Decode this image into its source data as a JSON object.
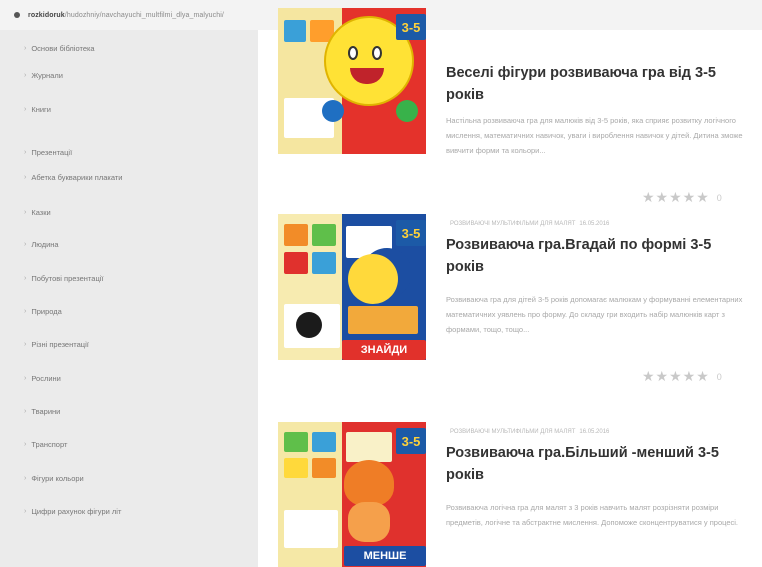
{
  "browser": {
    "url_prefix": "",
    "url_host": "rozkidoruk",
    "url_path": "/hudozhniy/navchayuchi_multfilmi_dlya_malyuchi/"
  },
  "sidebar": {
    "items": [
      {
        "label": "Основи бібліотека"
      },
      {
        "label": "Журнали"
      },
      {
        "label": "Книги"
      },
      {
        "label": "Презентації"
      },
      {
        "label": "Абетка букварики плакати"
      },
      {
        "label": "Казки"
      },
      {
        "label": "Людина"
      },
      {
        "label": "Побутові презентації"
      },
      {
        "label": "Природа"
      },
      {
        "label": "Різні презентації"
      },
      {
        "label": "Рослини"
      },
      {
        "label": "Тварини"
      },
      {
        "label": "Транспорт"
      },
      {
        "label": "Фігури кольори"
      },
      {
        "label": "Цифри рахунок фігури літ"
      }
    ]
  },
  "posts": [
    {
      "category": "",
      "date": "",
      "title": "Веселі фігури розвиваюча гра від 3-5 років",
      "excerpt": "Настільна розвиваюча гра для малюків від 3-5 років, яка сприяє розвитку логічного мислення, математичних навичок, уваги і вироблення навичок у дітей. Дитина зможе вивчити форми та кольори...",
      "stars": "★★★★★",
      "rating_count": "0",
      "badge": "3-5"
    },
    {
      "category": "РОЗВИВАЮЧІ МУЛЬТИФІЛЬМИ ДЛЯ МАЛЯТ",
      "date": "16.05.2016",
      "title": "Розвиваюча гра.Вгадай по формі 3-5 років",
      "excerpt": "Розвиваюча гра для дітей 3-5 років допомагає малюкам у формуванні елементарних математичних уявлень про форму. До складу гри входить набір малюнків карт з формами, тощо, тощо...",
      "stars": "★★★★★",
      "rating_count": "0",
      "badge": "3-5",
      "banner": "ЗНАЙДИ"
    },
    {
      "category": "РОЗВИВАЮЧІ МУЛЬТИФІЛЬМИ ДЛЯ МАЛЯТ",
      "date": "16.05.2016",
      "title": "Розвиваюча гра.Більший -менший 3-5 років",
      "excerpt": "Розвиваюча логічна гра для малят з 3 років навчить малят розрізняти розміри предметів, логічне та абстрактне мислення. Допоможе сконцентруватися у процесі.",
      "stars": "",
      "rating_count": "",
      "badge": "3-5",
      "banner": "МЕНШЕ"
    }
  ],
  "colors": {
    "sidebar_bg": "#ebebeb",
    "category": "#5fb8d9",
    "title": "#333333",
    "excerpt": "#a9a9a9",
    "stars": "#c9c9c9"
  }
}
